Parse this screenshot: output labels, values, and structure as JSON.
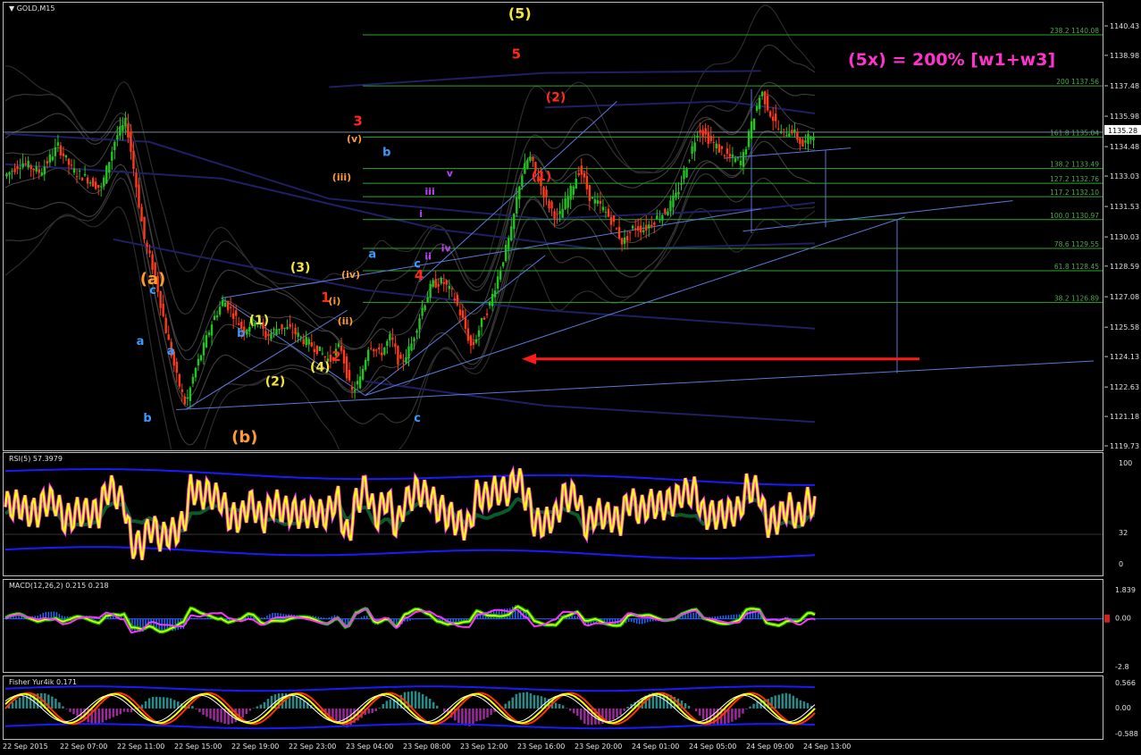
{
  "symbol_title": "GOLD,M15",
  "title_arrow": "▼",
  "headline": "(5x)  = 200% [w1+w3]",
  "colors": {
    "background": "#000000",
    "bull_candle": "#22c422",
    "bear_candle": "#ff3a1a",
    "fib_line": "#2aa82a",
    "rsi_line": "#ffff00",
    "wave_yellow": "#f5e63c",
    "wave_red": "#ff2a1a",
    "wave_blue": "#3a9bff",
    "wave_magenta": "#c040ff",
    "wave_orange": "#ff9933",
    "headline": "#ff33cc",
    "trend_line": "#5a78d8",
    "macd_hist": "#1a6aff",
    "fisher_pos": "#2a8a8a",
    "fisher_neg": "#9a2a9a"
  },
  "chart_data": [
    {
      "type": "candlestick",
      "title": "GOLD,M15",
      "ylim": [
        1119.73,
        1140.43
      ],
      "y_ticks": [
        "1140.43",
        "1138.98",
        "1137.48",
        "1135.98",
        "1134.48",
        "1133.03",
        "1131.53",
        "1130.03",
        "1128.59",
        "1127.08",
        "1125.58",
        "1124.13",
        "1122.63",
        "1121.18",
        "1119.73"
      ],
      "current_price": "1135.28",
      "x_ticks": [
        "22 Sep 2015",
        "22 Sep 07:00",
        "22 Sep 11:00",
        "22 Sep 15:00",
        "22 Sep 19:00",
        "22 Sep 23:00",
        "23 Sep 04:00",
        "23 Sep 08:00",
        "23 Sep 12:00",
        "23 Sep 16:00",
        "23 Sep 20:00",
        "24 Sep 01:00",
        "24 Sep 05:00",
        "24 Sep 09:00",
        "24 Sep 13:00"
      ],
      "price_path": [
        [
          0,
          1133.1
        ],
        [
          10,
          1133.8
        ],
        [
          20,
          1133.3
        ],
        [
          30,
          1134.6
        ],
        [
          38,
          1133.4
        ],
        [
          46,
          1133.0
        ],
        [
          54,
          1132.5
        ],
        [
          62,
          1135.0
        ],
        [
          68,
          1135.8
        ],
        [
          72,
          1133.5
        ],
        [
          78,
          1130.0
        ],
        [
          84,
          1128.2
        ],
        [
          90,
          1125.5
        ],
        [
          96,
          1123.2
        ],
        [
          101,
          1121.8
        ],
        [
          106,
          1123.5
        ],
        [
          111,
          1124.7
        ],
        [
          116,
          1126.0
        ],
        [
          122,
          1127.0
        ],
        [
          127,
          1126.4
        ],
        [
          133,
          1125.5
        ],
        [
          140,
          1126.1
        ],
        [
          146,
          1125.2
        ],
        [
          153,
          1125.7
        ],
        [
          160,
          1125.5
        ],
        [
          167,
          1125.0
        ],
        [
          174,
          1124.6
        ],
        [
          181,
          1124.0
        ],
        [
          187,
          1124.8
        ],
        [
          193,
          1122.4
        ],
        [
          198,
          1123.1
        ],
        [
          203,
          1124.9
        ],
        [
          209,
          1124.3
        ],
        [
          215,
          1125.2
        ],
        [
          220,
          1123.8
        ],
        [
          226,
          1124.7
        ],
        [
          232,
          1126.5
        ],
        [
          238,
          1127.8
        ],
        [
          244,
          1127.9
        ],
        [
          250,
          1127.2
        ],
        [
          255,
          1126.0
        ],
        [
          260,
          1124.6
        ],
        [
          265,
          1125.8
        ],
        [
          270,
          1126.8
        ],
        [
          276,
          1128.6
        ],
        [
          282,
          1130.4
        ],
        [
          287,
          1133.0
        ],
        [
          292,
          1134.1
        ],
        [
          296,
          1133.2
        ],
        [
          302,
          1131.8
        ],
        [
          308,
          1131.0
        ],
        [
          314,
          1132.2
        ],
        [
          320,
          1133.5
        ],
        [
          326,
          1132.0
        ],
        [
          332,
          1131.6
        ],
        [
          338,
          1130.9
        ],
        [
          344,
          1129.8
        ],
        [
          350,
          1130.6
        ],
        [
          356,
          1130.5
        ],
        [
          362,
          1131.0
        ],
        [
          368,
          1131.4
        ],
        [
          374,
          1132.2
        ],
        [
          380,
          1133.8
        ],
        [
          386,
          1135.5
        ],
        [
          392,
          1134.9
        ],
        [
          398,
          1134.4
        ],
        [
          404,
          1134.0
        ],
        [
          410,
          1133.8
        ],
        [
          416,
          1135.8
        ],
        [
          421,
          1137.3
        ],
        [
          426,
          1136.2
        ],
        [
          432,
          1135.2
        ],
        [
          438,
          1135.4
        ],
        [
          444,
          1134.6
        ],
        [
          450,
          1135.3
        ]
      ],
      "waves": [
        {
          "label": "(a)",
          "color": "orange",
          "size": "large"
        },
        {
          "label": "(b)",
          "color": "orange",
          "size": "large"
        },
        {
          "label": "(1)",
          "color": "yellow"
        },
        {
          "label": "(2)",
          "color": "yellow"
        },
        {
          "label": "(3)",
          "color": "yellow"
        },
        {
          "label": "(4)",
          "color": "yellow"
        },
        {
          "label": "(5)",
          "color": "yellow"
        },
        {
          "label": "1",
          "color": "red"
        },
        {
          "label": "2",
          "color": "red"
        },
        {
          "label": "3",
          "color": "red"
        },
        {
          "label": "4",
          "color": "red"
        },
        {
          "label": "5",
          "color": "red"
        },
        {
          "label": "(1)",
          "color": "red"
        },
        {
          "label": "(2)",
          "color": "red"
        },
        {
          "label": "a",
          "color": "blue"
        },
        {
          "label": "b",
          "color": "blue"
        },
        {
          "label": "c",
          "color": "blue"
        },
        {
          "label": "i",
          "color": "magenta"
        },
        {
          "label": "ii",
          "color": "magenta"
        },
        {
          "label": "iii",
          "color": "magenta"
        },
        {
          "label": "iv",
          "color": "magenta"
        },
        {
          "label": "v",
          "color": "magenta"
        },
        {
          "label": "(i)",
          "color": "orange"
        },
        {
          "label": "(ii)",
          "color": "orange"
        },
        {
          "label": "(iii)",
          "color": "orange"
        },
        {
          "label": "(iv)",
          "color": "orange"
        },
        {
          "label": "(v)",
          "color": "orange"
        }
      ],
      "fib_levels": [
        {
          "label": "238.2 1140.08",
          "price": 1140.08
        },
        {
          "label": "200 1137.56",
          "price": 1137.56
        },
        {
          "label": "161.8 1135.04",
          "price": 1135.04
        },
        {
          "label": "138.2 1133.49",
          "price": 1133.49
        },
        {
          "label": "127.2 1132.76",
          "price": 1132.76
        },
        {
          "label": "117.2 1132.10",
          "price": 1132.1
        },
        {
          "label": "100.0 1130.97",
          "price": 1130.97
        },
        {
          "label": "78.6 1129.55",
          "price": 1129.55
        },
        {
          "label": "61.8 1128.45",
          "price": 1128.45
        },
        {
          "label": "38.2 1126.89",
          "price": 1126.89
        }
      ]
    },
    {
      "type": "line",
      "title": "RSI(5) 57.3979",
      "ylim": [
        0,
        100
      ],
      "y_ticks": [
        "100",
        "32",
        "0"
      ],
      "series": [
        {
          "name": "RSI(5)",
          "last_value": 57.3979
        }
      ]
    },
    {
      "type": "line",
      "title": "MACD(12,26,2) 0.215 0.218",
      "ylim": [
        -2.8,
        1.839
      ],
      "y_ticks": [
        "1.839",
        "0.00",
        "-2.8"
      ],
      "series": [
        {
          "name": "MACD",
          "last_value": 0.215
        },
        {
          "name": "Signal",
          "last_value": 0.218
        }
      ]
    },
    {
      "type": "line",
      "title": "Fisher Yur4ik 0.171",
      "ylim": [
        -0.588,
        0.566
      ],
      "y_ticks": [
        "0.566",
        "0.00",
        "-0.588"
      ],
      "series": [
        {
          "name": "Fisher",
          "last_value": 0.171
        }
      ]
    }
  ]
}
